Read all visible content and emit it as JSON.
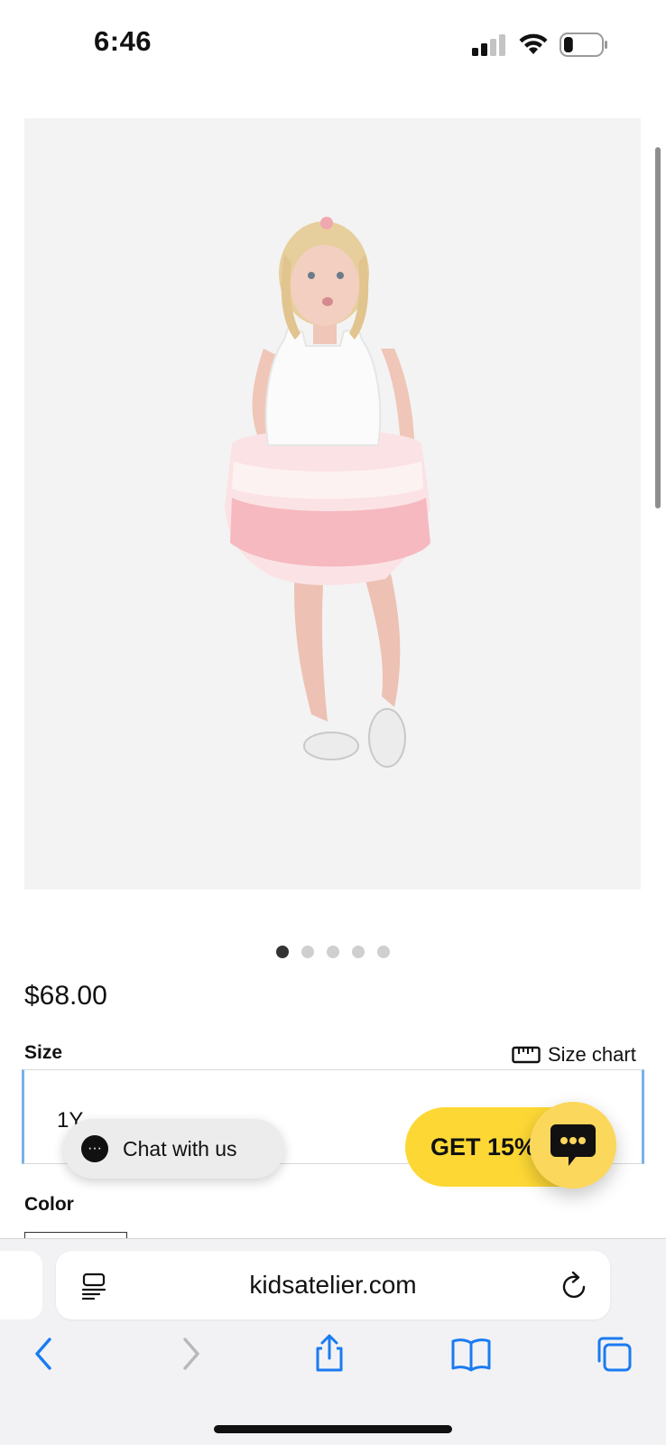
{
  "status_bar": {
    "time": "6:46",
    "battery_level": 0.25
  },
  "product": {
    "image_dots_total": 5,
    "image_dots_active_index": 0,
    "price": "$68.00"
  },
  "options": {
    "size_label": "Size",
    "size_chart_label": "Size chart",
    "size_selected": "1Y",
    "color_label": "Color"
  },
  "chat": {
    "label": "Chat with us"
  },
  "promo": {
    "label": "GET 15%"
  },
  "browser": {
    "url": "kidsatelier.com"
  },
  "colors": {
    "accent_yellow": "#fdd835",
    "safari_blue": "#1a7bf2",
    "select_focus": "#7ab0ea"
  },
  "icons": [
    "signal-icon",
    "wifi-icon",
    "battery-icon",
    "ruler-icon",
    "chat-bubble-icon",
    "reader-icon",
    "reload-icon",
    "back-icon",
    "forward-icon",
    "share-icon",
    "bookmarks-icon",
    "tabs-icon"
  ]
}
